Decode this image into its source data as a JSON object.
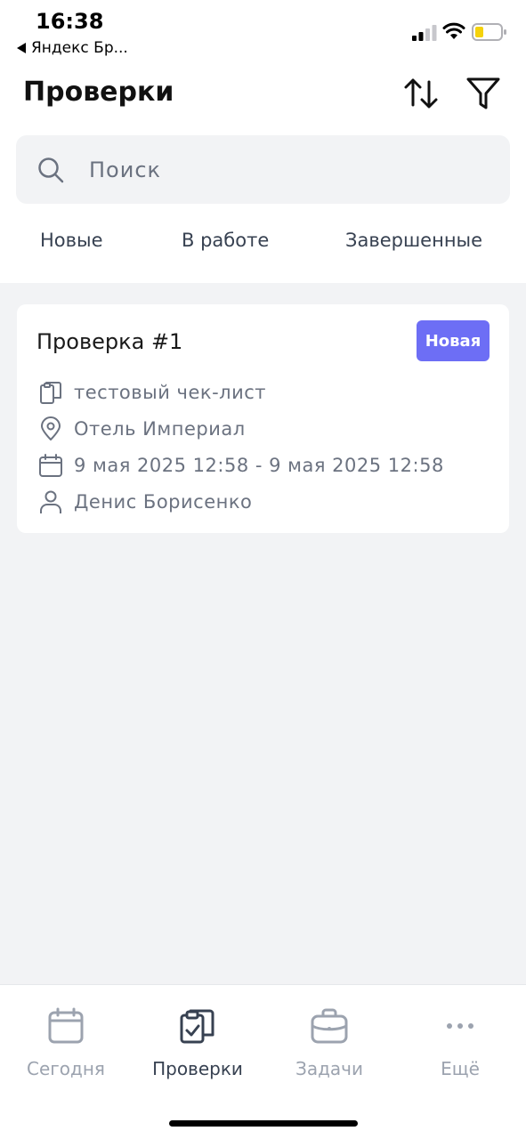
{
  "status_bar": {
    "time": "16:38",
    "back_label": "Яндекс Бр..."
  },
  "header": {
    "title": "Проверки",
    "sort_icon": "sort-arrows-icon",
    "filter_icon": "filter-funnel-icon"
  },
  "search": {
    "placeholder": "Поиск"
  },
  "tabs": [
    {
      "label": "Новые"
    },
    {
      "label": "В работе"
    },
    {
      "label": "Завершенные"
    }
  ],
  "cards": [
    {
      "title": "Проверка #1",
      "badge": "Новая",
      "checklist": "тестовый чек-лист",
      "location": "Отель Империал",
      "period": "9 мая 2025 12:58 - 9 мая 2025 12:58",
      "assignee": "Денис Борисенко"
    }
  ],
  "bottom_nav": [
    {
      "label": "Сегодня",
      "icon": "calendar-icon"
    },
    {
      "label": "Проверки",
      "icon": "clipboard-check-icon"
    },
    {
      "label": "Задачи",
      "icon": "briefcase-icon"
    },
    {
      "label": "Ещё",
      "icon": "more-dots-icon"
    }
  ],
  "colors": {
    "accent": "#6d6ef5",
    "background": "#f2f3f5",
    "muted_text": "#6b7280"
  }
}
